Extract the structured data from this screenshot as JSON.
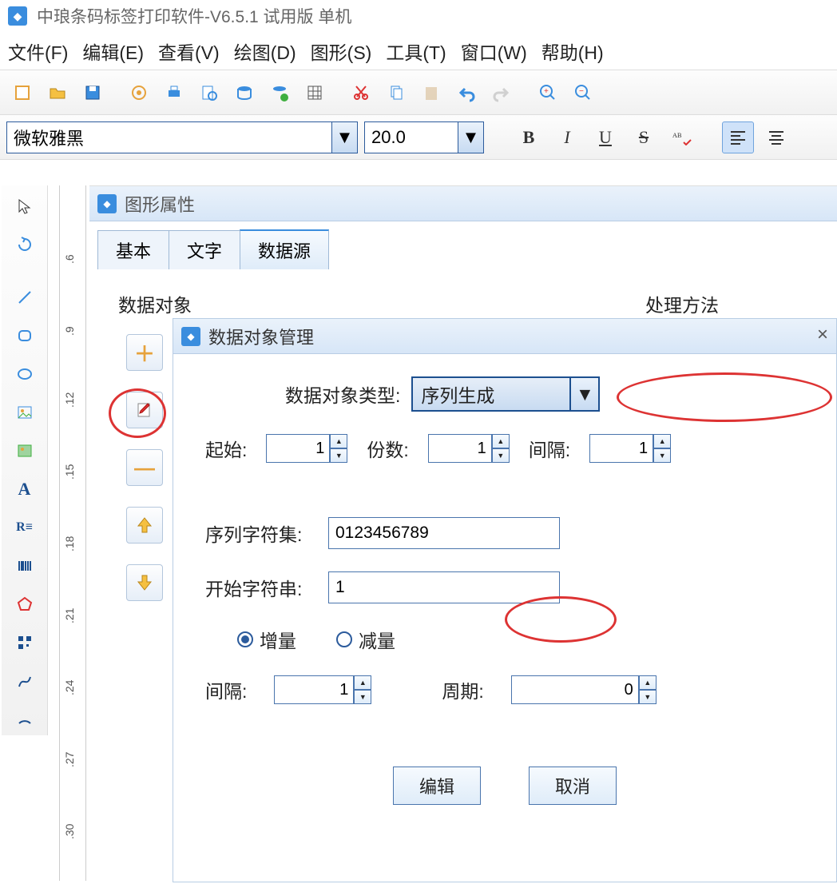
{
  "app_title": "中琅条码标签打印软件-V6.5.1 试用版 单机",
  "menu": {
    "file": "文件(F)",
    "edit": "编辑(E)",
    "view": "查看(V)",
    "draw": "绘图(D)",
    "shape": "图形(S)",
    "tools": "工具(T)",
    "window": "窗口(W)",
    "help": "帮助(H)"
  },
  "format": {
    "font": "微软雅黑",
    "size": "20.0",
    "bold": "B",
    "italic": "I",
    "underline": "U",
    "strike": "S"
  },
  "panel1": {
    "title": "图形属性",
    "tab_basic": "基本",
    "tab_text": "文字",
    "tab_datasource": "数据源",
    "label_dataobj": "数据对象",
    "label_method": "处理方法"
  },
  "dialog": {
    "title": "数据对象管理",
    "type_label": "数据对象类型:",
    "type_value": "序列生成",
    "start_label": "起始:",
    "start_value": "1",
    "copies_label": "份数:",
    "copies_value": "1",
    "gap_label": "间隔:",
    "gap_value": "1",
    "charset_label": "序列字符集:",
    "charset_value": "0123456789",
    "startstr_label": "开始字符串:",
    "startstr_value": "1",
    "inc_label": "增量",
    "dec_label": "减量",
    "interval_label": "间隔:",
    "interval_value": "1",
    "period_label": "周期:",
    "period_value": "0",
    "edit_btn": "编辑",
    "cancel_btn": "取消"
  },
  "ruler": {
    "t1": ".6",
    "t2": ".9",
    "t3": ".12",
    "t4": ".15",
    "t5": ".18",
    "t6": ".21",
    "t7": ".24",
    "t8": ".27",
    "t9": ".30"
  }
}
